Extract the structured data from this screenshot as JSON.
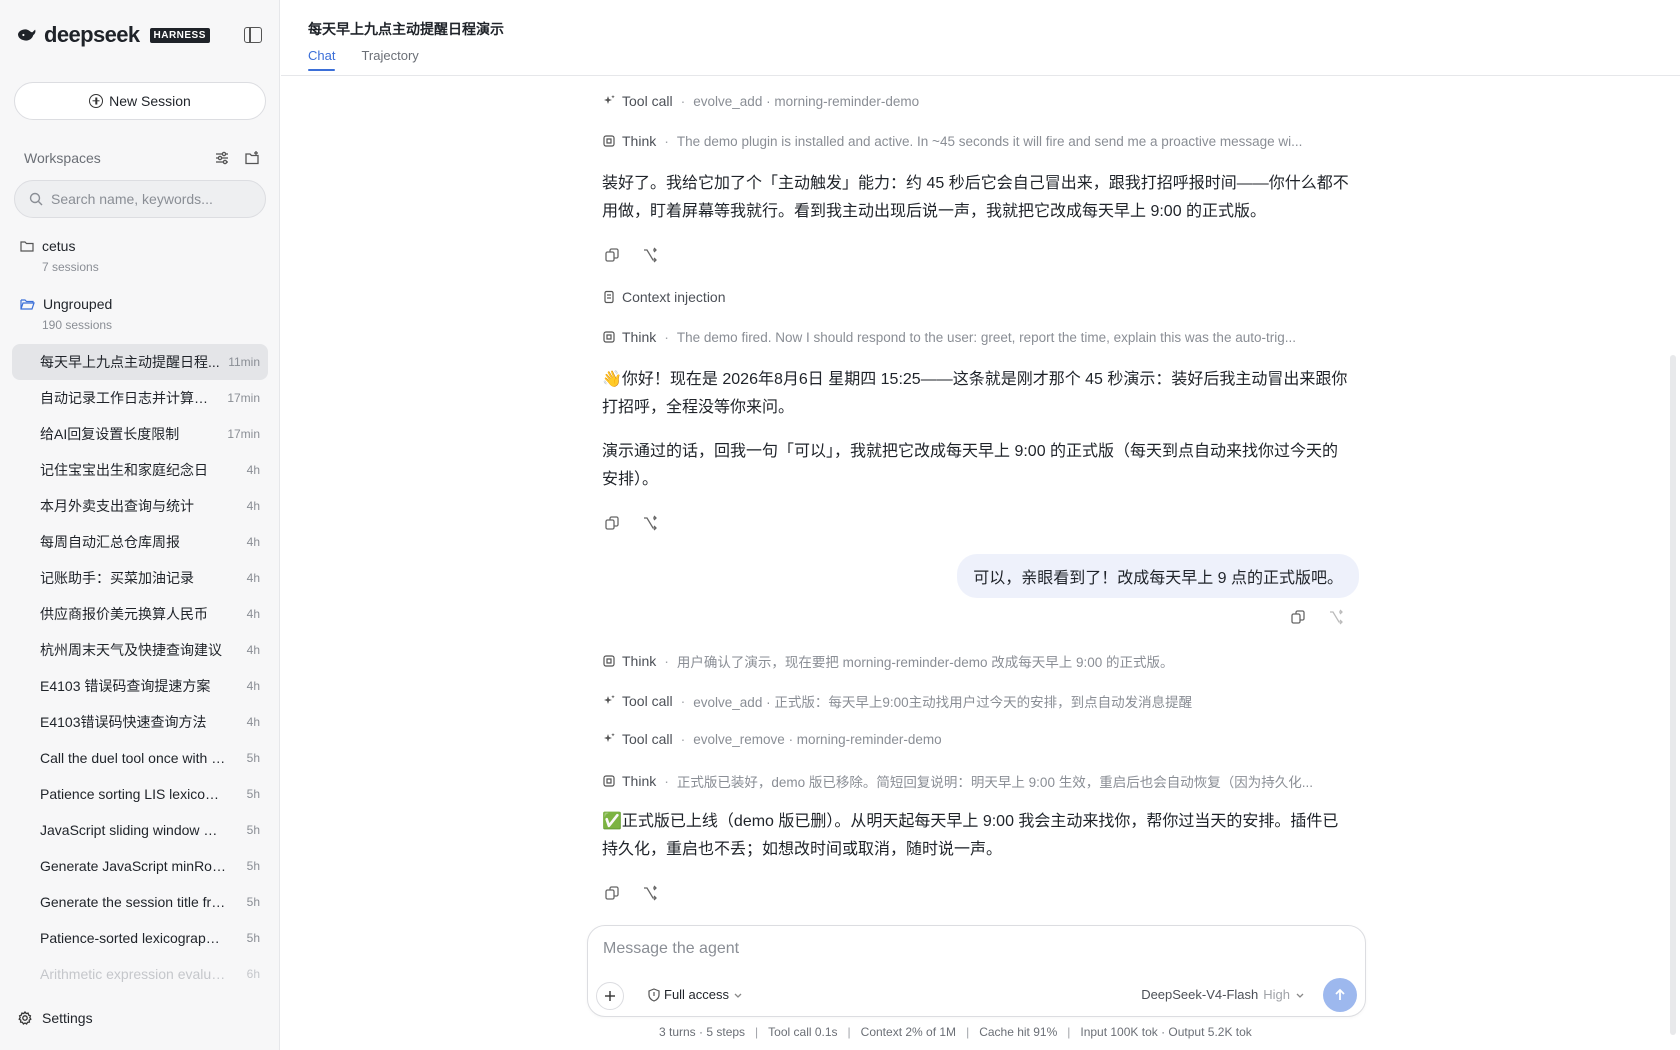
{
  "sidebar": {
    "brand": "deepseek",
    "badge": "HARNESS",
    "new_session_label": "New Session",
    "workspaces_title": "Workspaces",
    "search_placeholder": "Search name, keywords...",
    "folders": [
      {
        "name": "cetus",
        "count": "7 sessions"
      },
      {
        "name": "Ungrouped",
        "count": "190 sessions"
      }
    ],
    "sessions": [
      {
        "title": "每天早上九点主动提醒日程...",
        "time": "11min"
      },
      {
        "title": "自动记录工作日志并计算统...",
        "time": "17min"
      },
      {
        "title": "给AI回复设置长度限制",
        "time": "17min"
      },
      {
        "title": "记住宝宝出生和家庭纪念日",
        "time": "4h"
      },
      {
        "title": "本月外卖支出查询与统计",
        "time": "4h"
      },
      {
        "title": "每周自动汇总仓库周报",
        "time": "4h"
      },
      {
        "title": "记账助手：买菜加油记录",
        "time": "4h"
      },
      {
        "title": "供应商报价美元换算人民币",
        "time": "4h"
      },
      {
        "title": "杭州周末天气及快捷查询建议",
        "time": "4h"
      },
      {
        "title": "E4103 错误码查询提速方案",
        "time": "4h"
      },
      {
        "title": "E4103错误码快速查询方法",
        "time": "4h"
      },
      {
        "title": "Call the duel tool once with t...",
        "time": "5h"
      },
      {
        "title": "Patience sorting LIS lexicogr...",
        "time": "5h"
      },
      {
        "title": "JavaScript sliding window m...",
        "time": "5h"
      },
      {
        "title": "Generate JavaScript minRota...",
        "time": "5h"
      },
      {
        "title": "Generate the session title fro...",
        "time": "5h"
      },
      {
        "title": "Patience-sorted lexicographi...",
        "time": "5h"
      },
      {
        "title": "Arithmetic expression evalua...",
        "time": "6h"
      }
    ],
    "settings_label": "Settings"
  },
  "header": {
    "title": "每天早上九点主动提醒日程演示",
    "tabs": [
      "Chat",
      "Trajectory"
    ]
  },
  "chat": {
    "m1": {
      "label": "Tool call",
      "detail": "evolve_add · morning-reminder-demo"
    },
    "m2": {
      "label": "Think",
      "detail": "The demo plugin is installed and active. In ~45 seconds it will fire and send me a proactive message wi..."
    },
    "p1": "装好了。我给它加了个「主动触发」能力：约 45 秒后它会自己冒出来，跟我打招呼报时间——你什么都不用做，盯着屏幕等我就行。看到我主动出现后说一声，我就把它改成每天早上 9:00 的正式版。",
    "m3": {
      "label": "Context injection"
    },
    "m4": {
      "label": "Think",
      "detail": "The demo fired. Now I should respond to the user: greet, report the time, explain this was the auto-trig..."
    },
    "p2": "👋你好！现在是 2026年8月6日 星期四 15:25——这条就是刚才那个 45 秒演示：装好后我主动冒出来跟你打招呼，全程没等你来问。",
    "p3": "演示通过的话，回我一句「可以」，我就把它改成每天早上 9:00 的正式版（每天到点自动来找你过今天的安排）。",
    "user_msg": "可以，亲眼看到了！改成每天早上 9 点的正式版吧。",
    "m5": {
      "label": "Think",
      "detail": "用户确认了演示，现在要把 morning-reminder-demo 改成每天早上 9:00 的正式版。"
    },
    "m6": {
      "label": "Tool call",
      "detail": "evolve_add · 正式版：每天早上9:00主动找用户过今天的安排，到点自动发消息提醒"
    },
    "m7": {
      "label": "Tool call",
      "detail": "evolve_remove · morning-reminder-demo"
    },
    "m8": {
      "label": "Think",
      "detail": "正式版已装好，demo 版已移除。简短回复说明：明天早上 9:00 生效，重启后也会自动恢复（因为持久化..."
    },
    "p4": "✅正式版已上线（demo 版已删）。从明天起每天早上 9:00 我会主动来找你，帮你过当天的安排。插件已持久化，重启也不丢；如想改时间或取消，随时说一声。"
  },
  "composer": {
    "placeholder": "Message the agent",
    "access": "Full access",
    "model": "DeepSeek-V4-Flash",
    "level": "High"
  },
  "status": {
    "turns": "3 turns · 5 steps",
    "toolcall": "Tool call 0.1s",
    "context": "Context 2% of 1M",
    "cache": "Cache hit 91%",
    "tokens": "Input 100K tok · Output 5.2K tok"
  },
  "colors": {
    "accent": "#3b6fd8",
    "user_bubble": "#eef1fb",
    "send": "#9db8ee"
  }
}
